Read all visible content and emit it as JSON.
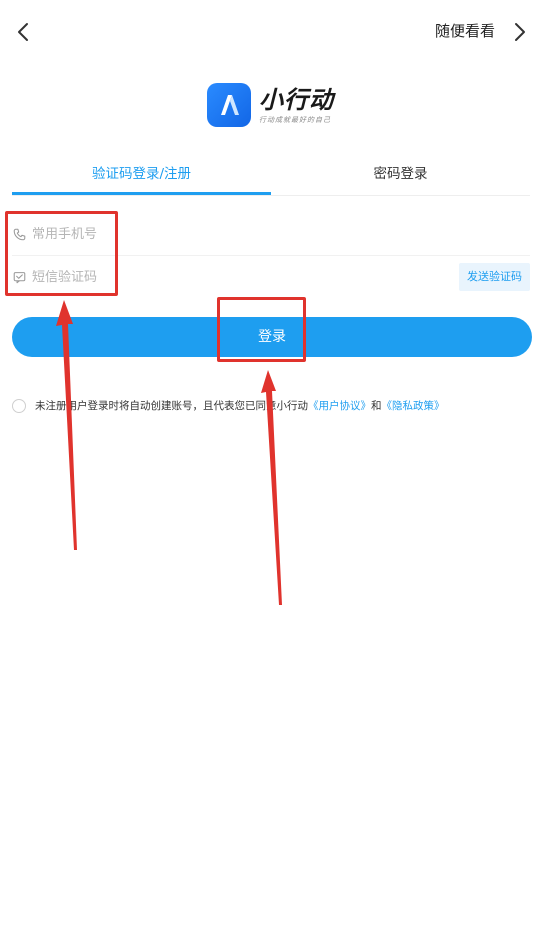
{
  "header": {
    "browse_label": "随便看看"
  },
  "logo": {
    "name": "小行动",
    "slogan": "行动成就最好的自己",
    "icon": "logo-a-icon"
  },
  "tabs": [
    {
      "label": "验证码登录/注册",
      "active": true
    },
    {
      "label": "密码登录",
      "active": false
    }
  ],
  "form": {
    "phone_placeholder": "常用手机号",
    "phone_value": "",
    "code_placeholder": "短信验证码",
    "code_value": "",
    "send_code_label": "发送验证码",
    "login_label": "登录"
  },
  "agreement": {
    "text": "未注册用户登录时将自动创建账号，且代表您已同意小行动",
    "user_agreement": "《用户协议》",
    "and": "和",
    "privacy_policy": "《隐私政策》",
    "checked": false
  },
  "colors": {
    "accent": "#1e9ef0",
    "annotation": "#e0332d",
    "send_code_bg": "#e9f4fd"
  }
}
